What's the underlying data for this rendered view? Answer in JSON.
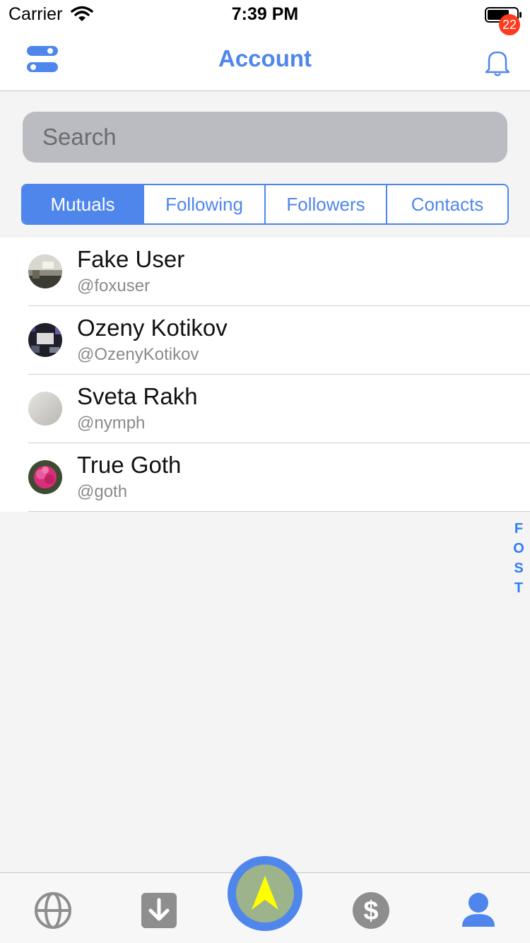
{
  "status_bar": {
    "carrier": "Carrier",
    "time": "7:39 PM"
  },
  "nav": {
    "title": "Account",
    "notification_count": "22"
  },
  "search": {
    "placeholder": "Search"
  },
  "segments": [
    {
      "label": "Mutuals",
      "active": true
    },
    {
      "label": "Following",
      "active": false
    },
    {
      "label": "Followers",
      "active": false
    },
    {
      "label": "Contacts",
      "active": false
    }
  ],
  "users": [
    {
      "name": "Fake User",
      "handle": "@foxuser"
    },
    {
      "name": "Ozeny Kotikov",
      "handle": "@OzenyKotikov"
    },
    {
      "name": "Sveta Rakh",
      "handle": "@nymph"
    },
    {
      "name": "True Goth",
      "handle": "@goth"
    }
  ],
  "section_index": [
    "F",
    "O",
    "S",
    "T"
  ],
  "tabs": [
    {
      "icon": "globe-icon"
    },
    {
      "icon": "download-icon"
    },
    {
      "icon": "navigate-arrow-icon"
    },
    {
      "icon": "dollar-icon"
    },
    {
      "icon": "profile-icon"
    }
  ],
  "colors": {
    "accent": "#4f86ec",
    "badge": "#ff3b1f",
    "center_arrow": "#ffff00",
    "index": "#2f7df6"
  }
}
